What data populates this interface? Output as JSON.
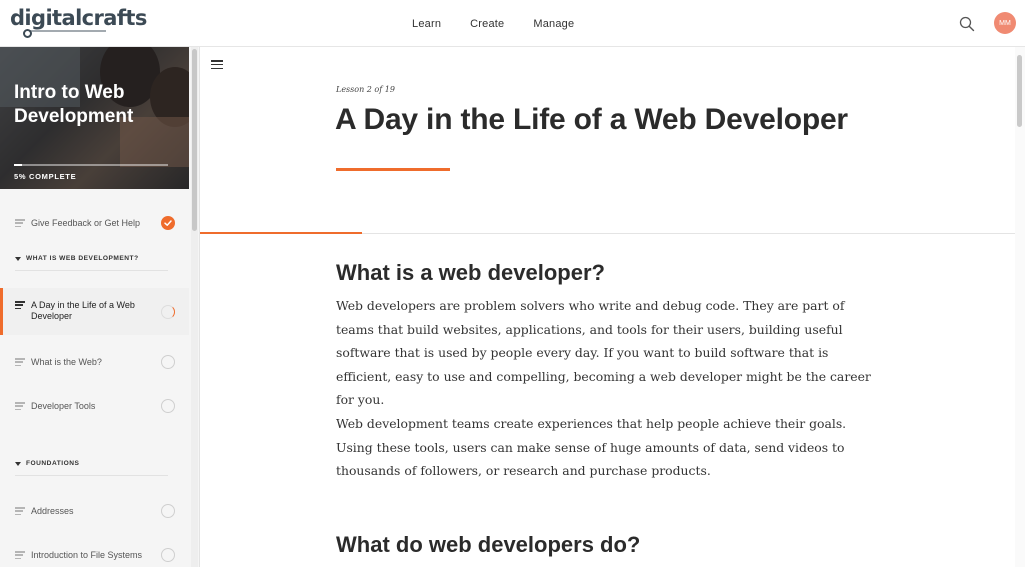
{
  "brand": {
    "logo_text": "digitalcrafts"
  },
  "nav": {
    "items": [
      "Learn",
      "Create",
      "Manage"
    ]
  },
  "user": {
    "initials": "MM"
  },
  "course": {
    "title": "Intro to Web Development",
    "progress_percent": 5,
    "progress_label": "5% COMPLETE"
  },
  "sidebar": {
    "feedback": "Give Feedback or Get Help",
    "sections": [
      {
        "title": "WHAT IS WEB DEVELOPMENT?",
        "lessons": [
          "A Day in the Life of a Web Developer",
          "What is the Web?",
          "Developer Tools"
        ]
      },
      {
        "title": "FOUNDATIONS",
        "lessons": [
          "Addresses",
          "Introduction to File Systems"
        ]
      }
    ]
  },
  "lesson": {
    "number": "Lesson 2 of 19",
    "title": "A Day in the Life of a Web Developer",
    "heading_1": "What is a web developer?",
    "paragraph_1": "Web developers are problem solvers who write and debug code. They are part of teams that build websites, applications, and tools for their users, building useful software that is used by people every day. If you want to build software that is efficient, easy to use and compelling, becoming a web developer might be the career for you.",
    "paragraph_2": "Web development teams create experiences that help people achieve their goals. Using these tools, users can make sense of huge amounts of data, send videos to thousands of followers, or research and purchase products.",
    "heading_2": "What do web developers do?"
  },
  "colors": {
    "accent": "#ef6c2c",
    "avatar": "#f08a72"
  }
}
